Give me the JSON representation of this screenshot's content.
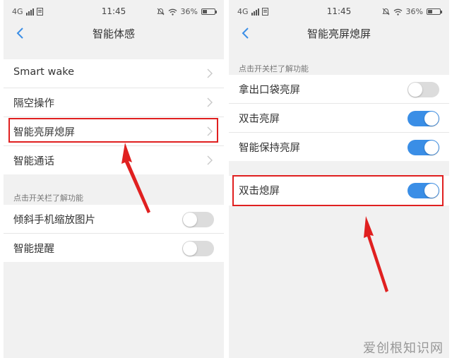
{
  "status_bar": {
    "network": "4G",
    "time": "11:45",
    "battery": "36%"
  },
  "left_screen": {
    "title": "智能体感",
    "nav_items": [
      {
        "label": "Smart wake"
      },
      {
        "label": "隔空操作"
      },
      {
        "label": "智能亮屏熄屏",
        "highlighted": true
      },
      {
        "label": "智能通话"
      }
    ],
    "section_hint": "点击开关栏了解功能",
    "toggles": [
      {
        "label": "倾斜手机缩放图片",
        "state": "off"
      },
      {
        "label": "智能提醒",
        "state": "off"
      }
    ]
  },
  "right_screen": {
    "title": "智能亮屏熄屏",
    "section_hint": "点击开关栏了解功能",
    "toggles": [
      {
        "label": "拿出口袋亮屏",
        "state": "off"
      },
      {
        "label": "双击亮屏",
        "state": "on"
      },
      {
        "label": "智能保持亮屏",
        "state": "on"
      }
    ],
    "highlighted_toggle": {
      "label": "双击熄屏",
      "state": "on"
    }
  },
  "annotation_color": "#e02020",
  "toggle_on_color": "#3a8ee6",
  "watermark": "爱创根知识网"
}
